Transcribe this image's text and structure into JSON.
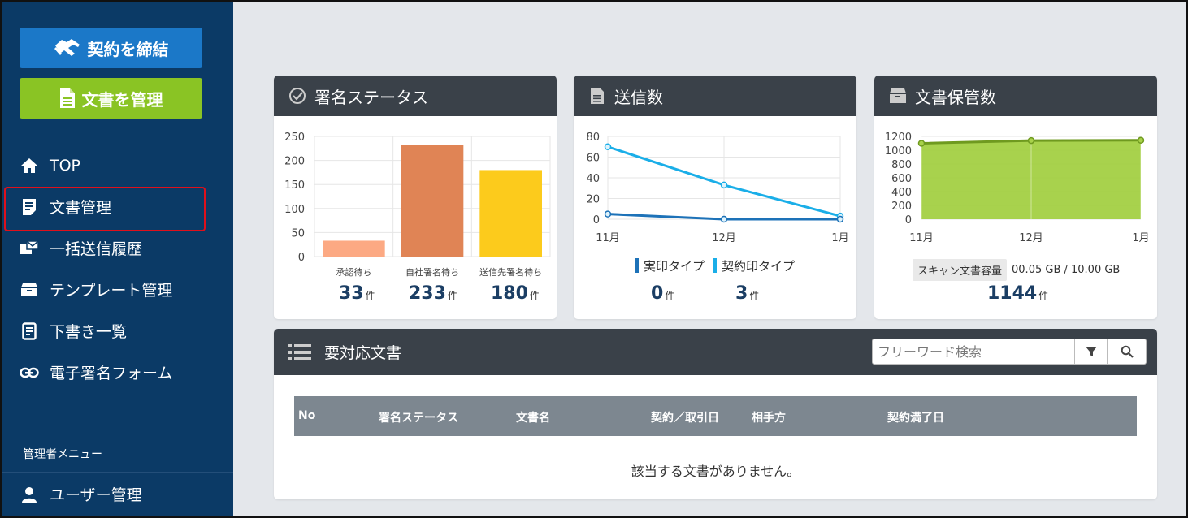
{
  "sidebar": {
    "contract_button": "契約を締結",
    "docs_button": "文書を管理",
    "items": [
      {
        "label": "TOP",
        "icon": "home-icon"
      },
      {
        "label": "文書管理",
        "icon": "document-icon"
      },
      {
        "label": "一括送信履歴",
        "icon": "bulk-send-icon"
      },
      {
        "label": "テンプレート管理",
        "icon": "template-icon"
      },
      {
        "label": "下書き一覧",
        "icon": "draft-icon"
      },
      {
        "label": "電子署名フォーム",
        "icon": "link-icon"
      }
    ],
    "admin_label": "管理者メニュー",
    "admin_items": [
      {
        "label": "ユーザー管理",
        "icon": "user-icon"
      }
    ],
    "active_index": 1
  },
  "cards": {
    "signature_status": {
      "title": "署名ステータス",
      "stats": [
        {
          "value": "33",
          "unit": "件"
        },
        {
          "value": "233",
          "unit": "件"
        },
        {
          "value": "180",
          "unit": "件"
        }
      ]
    },
    "sent_count": {
      "title": "送信数",
      "legend": [
        "実印タイプ",
        "契約印タイプ"
      ],
      "stats": [
        {
          "value": "0",
          "unit": "件"
        },
        {
          "value": "3",
          "unit": "件"
        }
      ]
    },
    "storage": {
      "title": "文書保管数",
      "capacity_label": "スキャン文書容量",
      "capacity_value": "00.05 GB / 10.00 GB",
      "stat": {
        "value": "1144",
        "unit": "件"
      }
    }
  },
  "chart_data": [
    {
      "type": "bar",
      "categories": [
        "承認待ち",
        "自社署名待ち",
        "送信先署名待ち"
      ],
      "values": [
        33,
        233,
        180
      ],
      "ylim": [
        0,
        250
      ],
      "yticks": [
        0,
        50,
        100,
        150,
        200,
        250
      ],
      "colors": [
        "#fca983",
        "#e08455",
        "#fccb1c"
      ]
    },
    {
      "type": "line",
      "categories": [
        "11月",
        "12月",
        "1月"
      ],
      "series": [
        {
          "name": "実印タイプ",
          "values": [
            5,
            0,
            0
          ],
          "color": "#1d72b8"
        },
        {
          "name": "契約印タイプ",
          "values": [
            70,
            33,
            3
          ],
          "color": "#1aaee8"
        }
      ],
      "ylim": [
        0,
        80
      ],
      "yticks": [
        0,
        20,
        40,
        60,
        80
      ]
    },
    {
      "type": "area",
      "categories": [
        "11月",
        "12月",
        "1月"
      ],
      "values": [
        1100,
        1140,
        1144
      ],
      "ylim": [
        0,
        1200
      ],
      "yticks": [
        0,
        200,
        400,
        600,
        800,
        1000,
        1200
      ],
      "color": "#9fcd3a"
    }
  ],
  "table": {
    "title": "要対応文書",
    "search_placeholder": "フリーワード検索",
    "columns": [
      "No",
      "署名ステータス",
      "文書名",
      "契約／取引日",
      "相手方",
      "契約満了日"
    ],
    "empty_message": "該当する文書がありません。"
  }
}
